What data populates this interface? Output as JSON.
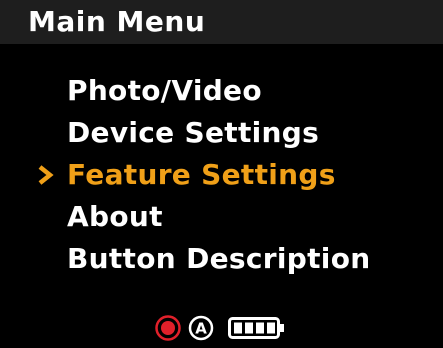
{
  "header": {
    "title": "Main Menu"
  },
  "menu": {
    "items": [
      {
        "label": "Photo/Video",
        "selected": false
      },
      {
        "label": "Device Settings",
        "selected": false
      },
      {
        "label": "Feature Settings",
        "selected": true
      },
      {
        "label": "About",
        "selected": false
      },
      {
        "label": "Button Description",
        "selected": false
      }
    ]
  },
  "status_bar": {
    "record_icon": "record-indicator-icon",
    "mode_icon": "auto-mode-icon",
    "mode_letter": "A",
    "battery_icon": "battery-icon",
    "battery_level": 1.0
  },
  "colors": {
    "background": "#000000",
    "header_background": "#1e1e1e",
    "text": "#ffffff",
    "selected": "#f0a018",
    "record": "#e0202a"
  }
}
